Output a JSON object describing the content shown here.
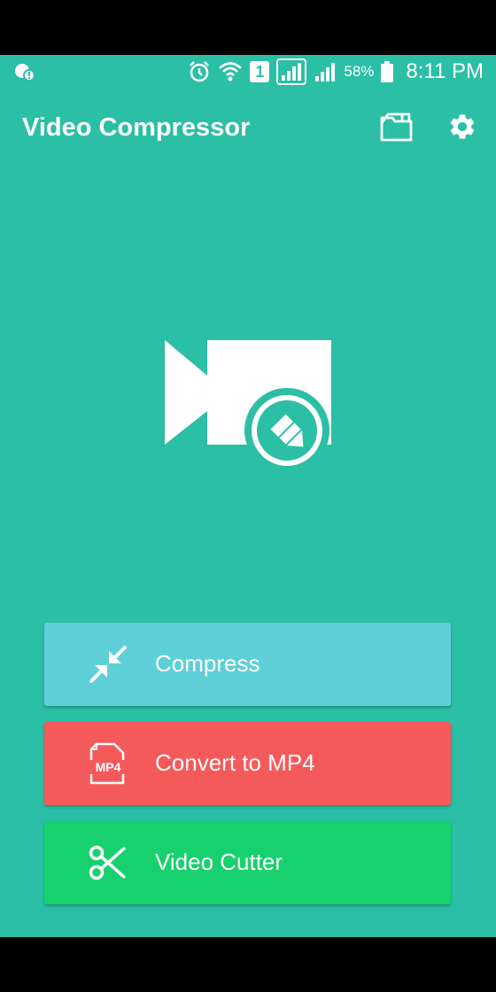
{
  "status_bar": {
    "battery_percent": "58%",
    "time": "8:11 PM",
    "sim_slot": "1",
    "icons": [
      "notification-icon",
      "alarm-icon",
      "wifi-icon",
      "sim-icon",
      "signal-icon",
      "signal-icon-2",
      "battery-icon"
    ]
  },
  "app_bar": {
    "title": "Video Compressor",
    "icons": [
      "folder-icon",
      "settings-icon"
    ]
  },
  "hero": {
    "icon": "video-edit-icon"
  },
  "actions": [
    {
      "label": "Compress",
      "icon": "compress-arrows-icon",
      "color": "#5ecfd6"
    },
    {
      "label": "Convert to MP4",
      "icon": "mp4-file-icon",
      "color": "#f55a5a",
      "icon_text": "MP4"
    },
    {
      "label": "Video Cutter",
      "icon": "scissors-icon",
      "color": "#16d16d"
    }
  ],
  "colors": {
    "background": "#2bbfa5",
    "accent_white": "#ffffff"
  }
}
